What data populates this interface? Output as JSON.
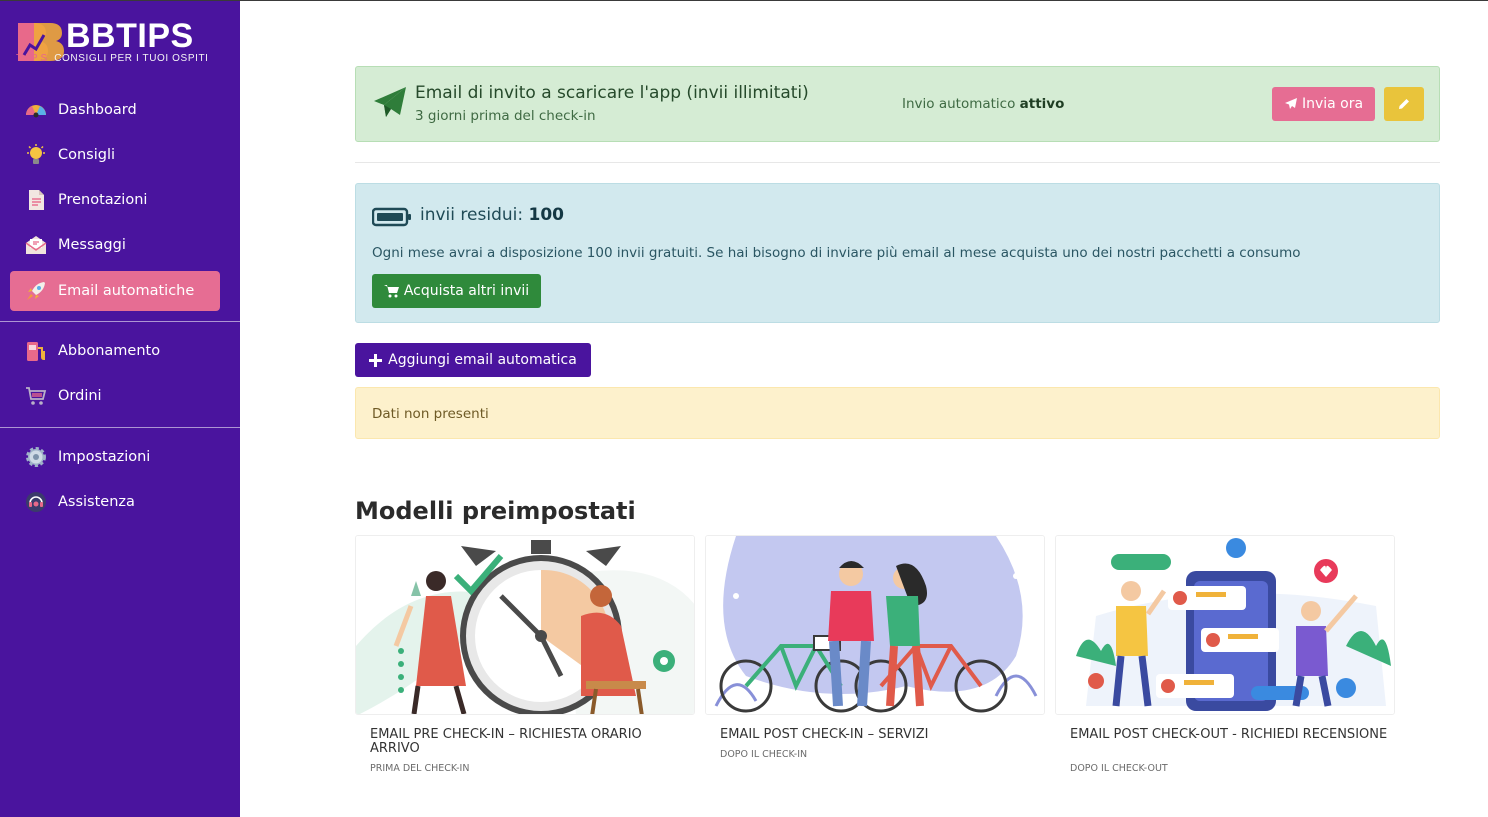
{
  "app": {
    "brand": "BBTIPS",
    "tagline_prefix": "TIPS",
    "tagline": "CONSIGLI PER I TUOI OSPITI"
  },
  "sidebar": {
    "items": [
      {
        "label": "Dashboard",
        "icon": "dashboard-gauge-icon"
      },
      {
        "label": "Consigli",
        "icon": "lightbulb-icon"
      },
      {
        "label": "Prenotazioni",
        "icon": "document-icon"
      },
      {
        "label": "Messaggi",
        "icon": "envelope-icon"
      },
      {
        "label": "Email automatiche",
        "icon": "rocket-icon",
        "active": true
      },
      {
        "label": "Abbonamento",
        "icon": "gas-pump-icon"
      },
      {
        "label": "Ordini",
        "icon": "shopping-cart-icon"
      },
      {
        "label": "Impostazioni",
        "icon": "gear-icon"
      },
      {
        "label": "Assistenza",
        "icon": "headset-icon"
      }
    ]
  },
  "invite_card": {
    "title": "Email di invito a scaricare l'app (invii illimitati)",
    "subtitle": "3 giorni prima del check-in",
    "status_prefix": "Invio automatico",
    "status_value": "attivo",
    "send_label": "Invia ora"
  },
  "credits": {
    "label": "invii residui:",
    "value": "100",
    "description": "Ogni mese avrai a disposizione 100 invii gratuiti. Se hai bisogno di inviare più email al mese acquista uno dei nostri pacchetti a consumo",
    "buy_label": "Acquista altri invii"
  },
  "add_button": "Aggiungi email automatica",
  "empty_message": "Dati non presenti",
  "templates": {
    "title": "Modelli preimpostati",
    "items": [
      {
        "name": "EMAIL PRE CHECK-IN – RICHIESTA ORARIO ARRIVO",
        "when": "PRIMA DEL CHECK-IN"
      },
      {
        "name": "EMAIL POST CHECK-IN – SERVIZI",
        "when": "DOPO IL CHECK-IN"
      },
      {
        "name": "EMAIL POST CHECK-OUT - RICHIEDI RECENSIONE",
        "when": "DOPO IL CHECK-OUT"
      }
    ]
  },
  "colors": {
    "sidebar_bg": "#4a149e",
    "active_item": "#e66d93",
    "success_bg": "#d5ecd4",
    "info_bg": "#d2e9ee",
    "warning_bg": "#fdf1cc",
    "send_button": "#e66d93",
    "edit_button": "#e9c43b",
    "buy_button": "#2f8a3b",
    "add_button": "#4a149e"
  }
}
